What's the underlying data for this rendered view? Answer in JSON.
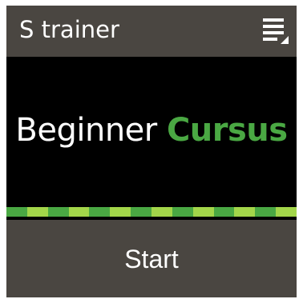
{
  "app": {
    "title": "S trainer"
  },
  "header": {
    "menu_icon": "list-menu-icon"
  },
  "course": {
    "level": "Beginner",
    "word": "Cursus"
  },
  "progress": {
    "segments": 14,
    "colors": [
      "#4aa843",
      "#a3d64a"
    ]
  },
  "start_button": {
    "label": "Start"
  },
  "colors": {
    "bar_background": "#4a4641",
    "screen_background": "#000000",
    "accent_green": "#4aa843",
    "text": "#ffffff"
  }
}
